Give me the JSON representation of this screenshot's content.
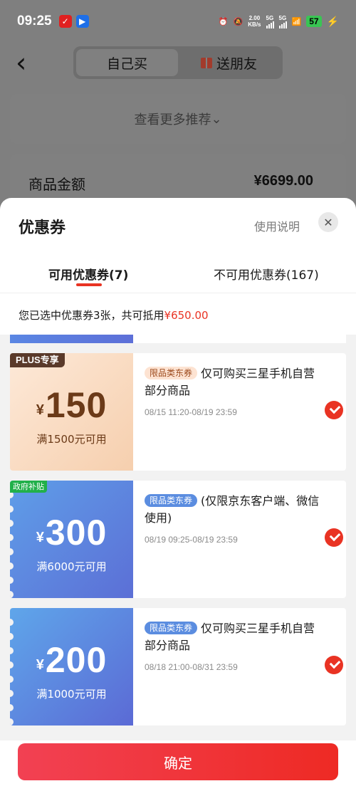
{
  "status_bar": {
    "time": "09:25",
    "speed_value": "2.00",
    "speed_unit": "KB/s",
    "net1": "5G",
    "net2": "5G",
    "battery": "57"
  },
  "header": {
    "tab_self": "自己买",
    "tab_gift": "送朋友"
  },
  "background": {
    "more_recommend": "查看更多推荐",
    "amount_label": "商品金额",
    "amount_value": "¥6699.00"
  },
  "sheet": {
    "title": "优惠券",
    "help": "使用说明",
    "tab_available": "可用优惠券(7)",
    "tab_unavailable": "不可用优惠券(167)",
    "summary_text": "您已选中优惠券3张，共可抵用",
    "summary_amount": "¥650.00",
    "coupons": [
      {
        "badge": "PLUS专享",
        "currency": "¥",
        "value": "150",
        "condition": "满1500元可用",
        "tag": "限品类东券",
        "desc": "仅可购买三星手机自营部分商品",
        "date": "08/15 11:20-08/19 23:59",
        "selected": true
      },
      {
        "badge": "政府补贴",
        "currency": "¥",
        "value": "300",
        "condition": "满6000元可用",
        "tag": "限品类东券",
        "desc": "(仅限京东客户端、微信使用)",
        "date": "08/19 09:25-08/19 23:59",
        "selected": true
      },
      {
        "badge": "",
        "currency": "¥",
        "value": "200",
        "condition": "满1000元可用",
        "tag": "限品类东券",
        "desc": "仅可购买三星手机自营部分商品",
        "date": "08/18 21:00-08/31 23:59",
        "selected": true
      }
    ],
    "confirm": "确定"
  },
  "colors": {
    "accent": "#e93323",
    "confirm_button": "#f23a3a",
    "plus_badge": "#5a3a2a",
    "gov_badge": "#21b04a"
  }
}
